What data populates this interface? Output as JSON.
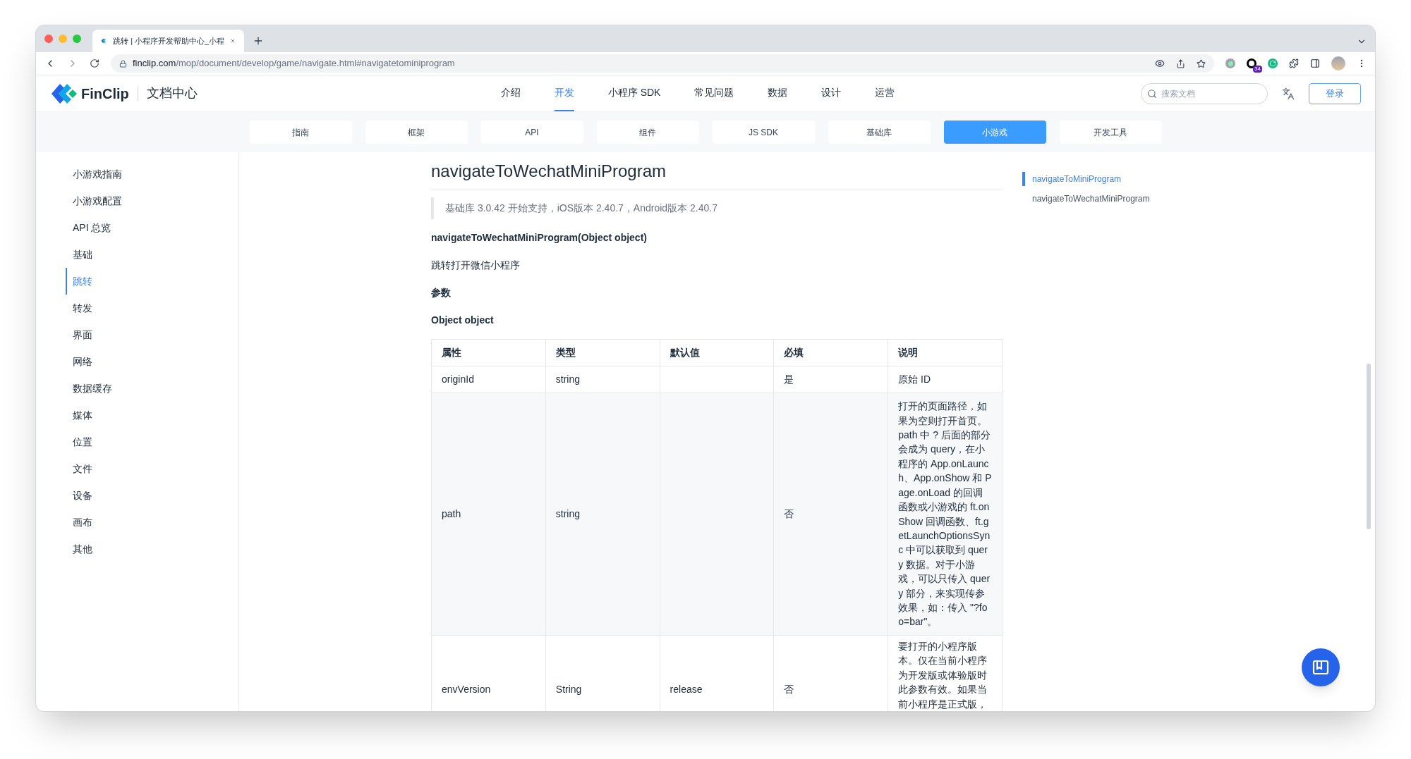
{
  "browser": {
    "tab_title": "跳转 | 小程序开发帮助中心_小程",
    "url": {
      "host": "finclip.com",
      "path": "/mop/document/develop/game/navigate.html#navigatetominiprogram"
    },
    "extension_badge": "34"
  },
  "header": {
    "logo": "FinClip",
    "section": "文档中心",
    "nav": [
      {
        "label": "介绍",
        "selected": false
      },
      {
        "label": "开发",
        "selected": true
      },
      {
        "label": "小程序 SDK",
        "selected": false
      },
      {
        "label": "常见问题",
        "selected": false
      },
      {
        "label": "数据",
        "selected": false
      },
      {
        "label": "设计",
        "selected": false
      },
      {
        "label": "运营",
        "selected": false
      }
    ],
    "search": {
      "placeholder": "搜索文档"
    },
    "login": "登录"
  },
  "subnav": [
    {
      "label": "指南",
      "selected": false
    },
    {
      "label": "框架",
      "selected": false
    },
    {
      "label": "API",
      "selected": false
    },
    {
      "label": "组件",
      "selected": false
    },
    {
      "label": "JS SDK",
      "selected": false
    },
    {
      "label": "基础库",
      "selected": false
    },
    {
      "label": "小游戏",
      "selected": true
    },
    {
      "label": "开发工具",
      "selected": false
    }
  ],
  "sidebar": {
    "items": [
      {
        "label": "小游戏指南",
        "selected": false
      },
      {
        "label": "小游戏配置",
        "selected": false
      },
      {
        "label": "API 总览",
        "selected": false
      },
      {
        "label": "基础",
        "selected": false
      },
      {
        "label": "跳转",
        "selected": true
      },
      {
        "label": "转发",
        "selected": false
      },
      {
        "label": "界面",
        "selected": false
      },
      {
        "label": "网络",
        "selected": false
      },
      {
        "label": "数据缓存",
        "selected": false
      },
      {
        "label": "媒体",
        "selected": false
      },
      {
        "label": "位置",
        "selected": false
      },
      {
        "label": "文件",
        "selected": false
      },
      {
        "label": "设备",
        "selected": false
      },
      {
        "label": "画布",
        "selected": false
      },
      {
        "label": "其他",
        "selected": false
      }
    ]
  },
  "article": {
    "title": "navigateToWechatMiniProgram",
    "note": "基础库 3.0.42 开始支持，iOS版本 2.40.7，Android版本 2.40.7",
    "signature": "navigateToWechatMiniProgram(Object object)",
    "description": "跳转打开微信小程序",
    "params_heading": "参数",
    "object_heading": "Object object",
    "table": {
      "columns": [
        "属性",
        "类型",
        "默认值",
        "必填",
        "说明"
      ],
      "rows": [
        [
          "originId",
          "string",
          "",
          "是",
          "原始 ID"
        ],
        [
          "path",
          "string",
          "",
          "否",
          "打开的页面路径，如果为空则打开首页。path 中 ? 后面的部分会成为 query，在小程序的 App.onLaunch、App.onShow 和 Page.onLoad 的回调函数或小游戏的 ft.onShow 回调函数、ft.getLaunchOptionsSync 中可以获取到 query 数据。对于小游戏，可以只传入 query 部分，来实现传参效果，如：传入 \"?foo=bar\"。"
        ],
        [
          "envVersion",
          "String",
          "release",
          "否",
          "要打开的小程序版本。仅在当前小程序为开发版或体验版时此参数有效。如果当前小程序是正式版，"
        ]
      ]
    }
  },
  "toc": [
    {
      "label": "navigateToMiniProgram",
      "selected": true
    },
    {
      "label": "navigateToWechatMiniProgram",
      "selected": false
    }
  ]
}
